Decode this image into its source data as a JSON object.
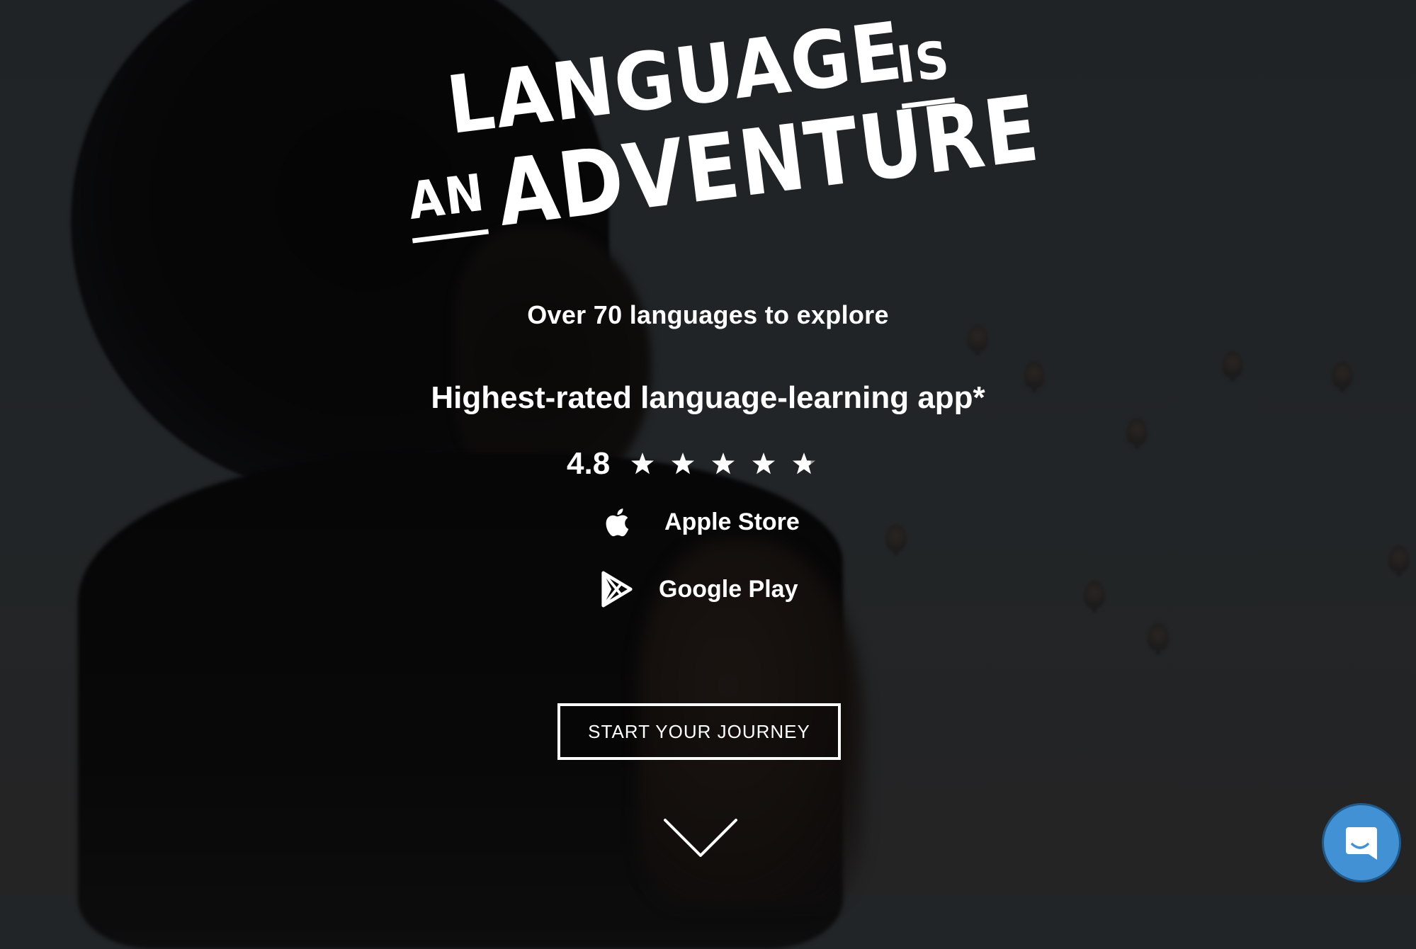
{
  "hero": {
    "headline": {
      "word1": "LANGUAGE",
      "word2": "IS",
      "word3": "AN",
      "word4": "ADVENTURE"
    },
    "tagline": "Over 70 languages to explore",
    "rated_text": "Highest-rated language-learning app*",
    "rating": {
      "value": "4.8",
      "stars_filled": 4.8,
      "stars_total": 5
    },
    "stores": [
      {
        "label": "Apple Store",
        "icon": "apple-icon"
      },
      {
        "label": "Google Play",
        "icon": "google-play-icon"
      }
    ],
    "cta_label": "START YOUR JOURNEY",
    "scroll_icon": "chevron-down-icon"
  },
  "chat_widget": {
    "icon": "chat-smile-icon",
    "color": "#4191d4"
  },
  "colors": {
    "background": "#222527",
    "text": "#ffffff",
    "star_empty": "#9a9a9a"
  }
}
